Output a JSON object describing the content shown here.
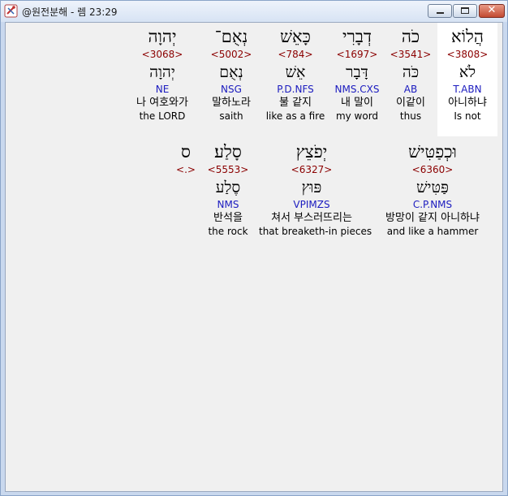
{
  "window": {
    "title": "@원전분해 - 렘 23:29",
    "icon": "bible-analysis-app-icon",
    "buttons": {
      "minimize": "minimize-icon",
      "maximize": "maximize-icon",
      "close": "✕"
    }
  },
  "rows": [
    [
      {
        "hebrew": "הֲלוֹא",
        "code": "<3808>",
        "lemma": "לֹא",
        "morph": "T.ABN",
        "korean": "아니하냐",
        "english": "Is not",
        "highlight": true
      },
      {
        "hebrew": "כֹה",
        "code": "<3541>",
        "lemma": "כֹּה",
        "morph": "AB",
        "korean": "이같이",
        "english": "thus"
      },
      {
        "hebrew": "דְבָרִי",
        "code": "<1697>",
        "lemma": "דָּבָר",
        "morph": "NMS.CXS",
        "korean": "내 말이",
        "english": "my word"
      },
      {
        "hebrew": "כָּאֵשׁ",
        "code": "<784>",
        "lemma": "אֵשׁ",
        "morph": "P.D.NFS",
        "korean": "불 같지",
        "english": "like as a fire"
      },
      {
        "hebrew": "נְאֻם־",
        "code": "<5002>",
        "lemma": "נְאֻם",
        "morph": "NSG",
        "korean": "말하노라",
        "english": "saith"
      },
      {
        "hebrew": "יְהוָה",
        "code": "<3068>",
        "lemma": "יְהוָה",
        "morph": "NE",
        "korean": "나 여호와가",
        "english": "the LORD"
      }
    ],
    [
      {
        "hebrew": "וּכְפַטִּישׁ",
        "code": "<6360>",
        "lemma": "פַּטִּישׁ",
        "morph": "C.P.NMS",
        "korean": "방망이 같지 아니하냐",
        "english": "and like a hammer"
      },
      {
        "hebrew": "יְפֹצֵץ",
        "code": "<6327>",
        "lemma": "פּוּץ",
        "morph": "VPIMZS",
        "korean": "쳐서 부스러뜨리는",
        "english": "that breaketh-in pieces"
      },
      {
        "hebrew": "סָלַע׃",
        "code": "<5553>",
        "lemma": "סֶלַע",
        "morph": "NMS",
        "korean": "반석을",
        "english": "the rock"
      },
      {
        "hebrew": "ס",
        "code": "<.>",
        "lemma": "",
        "morph": "",
        "korean": "",
        "english": ""
      }
    ]
  ]
}
